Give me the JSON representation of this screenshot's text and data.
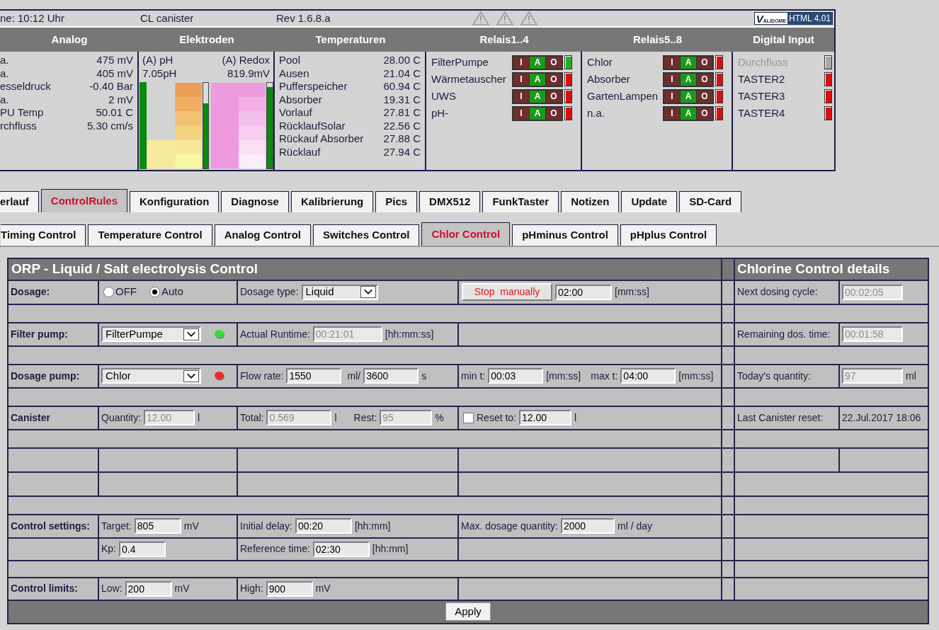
{
  "status_bar": {
    "time": "ne: 10:12 Uhr",
    "name": "CL canister",
    "revision": "Rev 1.6.8.a",
    "badge_logo_initial": "V",
    "badge_logo": "ALIDOME",
    "badge_label": "HTML 4.01"
  },
  "overview": {
    "analog": {
      "title": "Analog",
      "rows": [
        {
          "label": "a.",
          "value": "475 mV"
        },
        {
          "label": "a.",
          "value": "405 mV"
        },
        {
          "label": "esseldruck",
          "value": "-0.40 Bar"
        },
        {
          "label": "a.",
          "value": "2 mV"
        },
        {
          "label": "PU Temp",
          "value": "50.01 C"
        },
        {
          "label": "rchfluss",
          "value": "5.30 cm/s"
        }
      ]
    },
    "electrodes": {
      "title": "Elektroden",
      "ph": {
        "label": "(A) pH",
        "value": "7.05pH",
        "level": 0.76
      },
      "redox": {
        "label": "(A) Redox",
        "value": "819.9mV",
        "level": 0.95
      }
    },
    "temperatures": {
      "title": "Temperaturen",
      "rows": [
        {
          "label": "Pool",
          "value": "28.00 C"
        },
        {
          "label": "Ausen",
          "value": "21.04 C"
        },
        {
          "label": "Pufferspeicher",
          "value": "60.94 C"
        },
        {
          "label": "Absorber",
          "value": "19.31 C"
        },
        {
          "label": "Vorlauf",
          "value": "27.81 C"
        },
        {
          "label": "RücklaufSolar",
          "value": "22.56 C"
        },
        {
          "label": "Rückauf Absorber",
          "value": "27.88 C"
        },
        {
          "label": "Rücklauf",
          "value": "27.94 C"
        }
      ]
    },
    "relays_1": {
      "title": "Relais1..4",
      "items": [
        {
          "name": "FilterPumpe",
          "on": true,
          "modes": [
            {
              "label": "I",
              "selected": false
            },
            {
              "label": "A",
              "selected": true
            },
            {
              "label": "O",
              "selected": false
            }
          ]
        },
        {
          "name": "Wärmetauscher",
          "on": false,
          "modes": [
            {
              "label": "I",
              "selected": false
            },
            {
              "label": "A",
              "selected": true
            },
            {
              "label": "O",
              "selected": false
            }
          ]
        },
        {
          "name": "UWS",
          "on": false,
          "modes": [
            {
              "label": "I",
              "selected": false
            },
            {
              "label": "A",
              "selected": true
            },
            {
              "label": "O",
              "selected": false
            }
          ]
        },
        {
          "name": "pH-",
          "on": false,
          "modes": [
            {
              "label": "I",
              "selected": false
            },
            {
              "label": "A",
              "selected": true
            },
            {
              "label": "O",
              "selected": false
            }
          ]
        }
      ]
    },
    "relays_2": {
      "title": "Relais5..8",
      "items": [
        {
          "name": "Chlor",
          "on": false,
          "modes": [
            {
              "label": "I",
              "selected": false
            },
            {
              "label": "A",
              "selected": true
            },
            {
              "label": "O",
              "selected": false
            }
          ]
        },
        {
          "name": "Absorber",
          "on": false,
          "modes": [
            {
              "label": "I",
              "selected": false
            },
            {
              "label": "A",
              "selected": true
            },
            {
              "label": "O",
              "selected": false
            }
          ]
        },
        {
          "name": "GartenLampen",
          "on": false,
          "modes": [
            {
              "label": "I",
              "selected": false
            },
            {
              "label": "A",
              "selected": true
            },
            {
              "label": "O",
              "selected": false
            }
          ]
        },
        {
          "name": "n.a.",
          "on": false,
          "modes": [
            {
              "label": "I",
              "selected": false
            },
            {
              "label": "A",
              "selected": true
            },
            {
              "label": "O",
              "selected": false
            }
          ]
        }
      ]
    },
    "digital_input": {
      "title": "Digital Input",
      "items": [
        {
          "name": "Durchfluss",
          "disabled": true,
          "on": false
        },
        {
          "name": "TASTER2",
          "disabled": false,
          "on": false
        },
        {
          "name": "TASTER3",
          "disabled": false,
          "on": false
        },
        {
          "name": "TASTER4",
          "disabled": false,
          "on": false
        }
      ]
    }
  },
  "main_tabs": [
    {
      "label": "erlauf",
      "selected": false
    },
    {
      "label": "ControlRules",
      "selected": true
    },
    {
      "label": "Konfiguration",
      "selected": false
    },
    {
      "label": "Diagnose",
      "selected": false
    },
    {
      "label": "Kalibrierung",
      "selected": false
    },
    {
      "label": "Pics",
      "selected": false
    },
    {
      "label": "DMX512",
      "selected": false
    },
    {
      "label": "FunkTaster",
      "selected": false
    },
    {
      "label": "Notizen",
      "selected": false
    },
    {
      "label": "Update",
      "selected": false
    },
    {
      "label": "SD-Card",
      "selected": false
    }
  ],
  "sub_tabs": [
    {
      "label": "Timing Control",
      "selected": false
    },
    {
      "label": "Temperature Control",
      "selected": false
    },
    {
      "label": "Analog Control",
      "selected": false
    },
    {
      "label": "Switches Control",
      "selected": false
    },
    {
      "label": "Chlor Control",
      "selected": true
    },
    {
      "label": "pHminus Control",
      "selected": false
    },
    {
      "label": "pHplus Control",
      "selected": false
    }
  ],
  "form": {
    "title": "ORP - Liquid / Salt electrolysis Control",
    "dosage": {
      "label": "Dosage:",
      "options": [
        {
          "label": "OFF",
          "selected": false
        },
        {
          "label": "Auto",
          "selected": true
        }
      ],
      "type_label": "Dosage type:",
      "type_value": "Liquid",
      "stop_button": "Stop  manually",
      "duration": {
        "value": "02:00",
        "disabled": false
      },
      "duration_unit": "[mm:ss]"
    },
    "filter_pump": {
      "label": "Filter pump:",
      "value": "FilterPumpe",
      "running": true,
      "runtime_label": "Actual Runtime:",
      "runtime": {
        "value": "00:21:01",
        "disabled": true
      },
      "runtime_unit": "[hh:mm:ss]"
    },
    "dosage_pump": {
      "label": "Dosage pump:",
      "value": "Chlor",
      "running": false,
      "flow_label": "Flow rate:",
      "flow_ml": {
        "value": "1550",
        "disabled": false
      },
      "ml_unit": "ml/",
      "flow_s": {
        "value": "3600",
        "disabled": false
      },
      "s_unit": "s",
      "min_label": "min t:",
      "min": {
        "value": "00:03",
        "disabled": false
      },
      "min_unit": "[mm:ss]",
      "max_label": "max t:",
      "max": {
        "value": "04:00",
        "disabled": false
      },
      "max_unit": "[mm:ss]"
    },
    "canister": {
      "label": "Canister",
      "quantity_label": "Quantity:",
      "quantity": {
        "value": "12.00",
        "disabled": true
      },
      "quantity_unit": "l",
      "total_label": "Total:",
      "total": {
        "value": "0.569",
        "disabled": true
      },
      "total_unit": "l",
      "rest_label": "Rest:",
      "rest": {
        "value": "95",
        "disabled": true
      },
      "rest_unit": "%",
      "reset_checked": false,
      "reset_label": "Reset to:",
      "reset_value": {
        "value": "12.00",
        "disabled": false
      },
      "reset_unit": "l"
    },
    "control_settings": {
      "label": "Control settings:",
      "target_label": "Target:",
      "target": {
        "value": "805",
        "disabled": false
      },
      "target_unit": "mV",
      "delay_label": "Initial delay:",
      "delay": {
        "value": "00:20",
        "disabled": false
      },
      "delay_unit": "[hh:mm]",
      "max_label": "Max. dosage quantity:",
      "max": {
        "value": "2000",
        "disabled": false
      },
      "max_unit": "ml / day",
      "kp_label": "Kp:",
      "kp": {
        "value": "0.4",
        "disabled": false
      },
      "ref_label": "Reference time:",
      "ref": {
        "value": "02:30",
        "disabled": false
      },
      "ref_unit": "[hh:mm]"
    },
    "control_limits": {
      "label": "Control limits:",
      "low_label": "Low:",
      "low": {
        "value": "200",
        "disabled": false
      },
      "low_unit": "mV",
      "high_label": "High:",
      "high": {
        "value": "900",
        "disabled": false
      },
      "high_unit": "mV"
    },
    "apply": "Apply"
  },
  "details": {
    "title": "Chlorine Control details",
    "rows": [
      {
        "kind": "field",
        "label": "Next dosing cycle:",
        "field": {
          "value": "00:02:05",
          "disabled": true
        }
      },
      {
        "kind": "field",
        "label": "Remaining dos. time:",
        "field": {
          "value": "00:01:58",
          "disabled": true
        }
      },
      {
        "kind": "field",
        "label": "Today's quantity:",
        "field": {
          "value": "97",
          "disabled": true
        },
        "unit": "ml"
      },
      {
        "kind": "text",
        "label": "Last Canister reset:",
        "value": "22.Jul.2017 18:06"
      }
    ]
  }
}
